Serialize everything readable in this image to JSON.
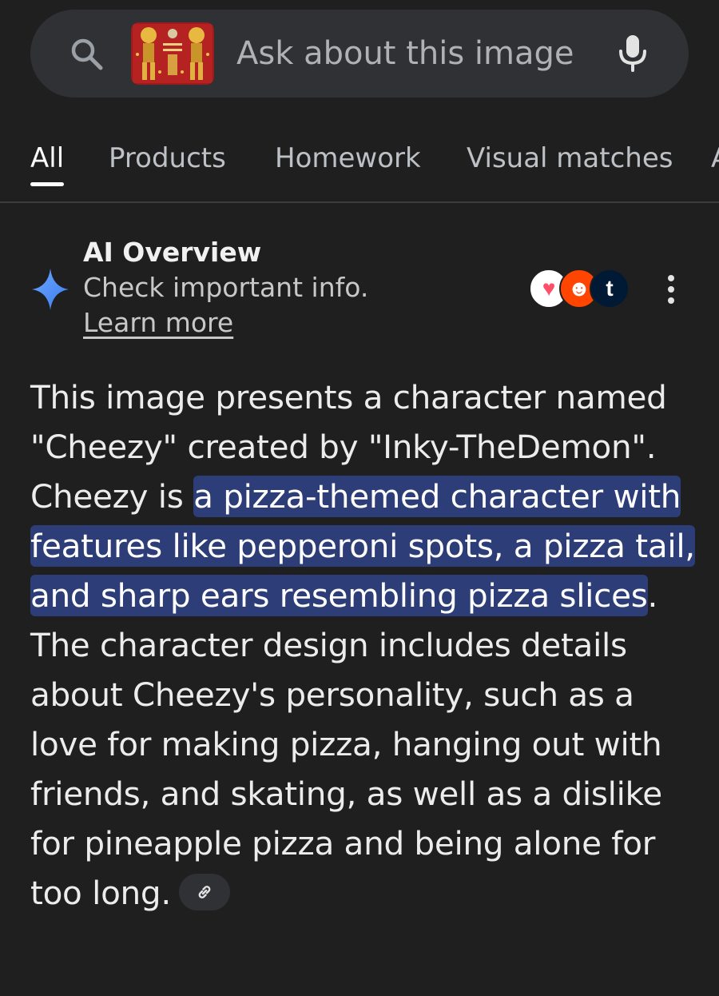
{
  "search": {
    "placeholder": "Ask about this image",
    "thumbnail_icon": "character-sheet-thumbnail",
    "search_icon": "search-icon",
    "mic_icon": "mic-icon"
  },
  "tabs": [
    {
      "label": "All",
      "active": true
    },
    {
      "label": "Products",
      "active": false
    },
    {
      "label": "Homework",
      "active": false
    },
    {
      "label": "Visual matches",
      "active": false
    },
    {
      "label": "A",
      "active": false
    }
  ],
  "ai_overview": {
    "title": "AI Overview",
    "subtitle": "Check important info.",
    "learn_more": "Learn more",
    "sources": [
      {
        "name": "tinder-source-icon",
        "glyph": "♥"
      },
      {
        "name": "reddit-source-icon",
        "glyph": "☻"
      },
      {
        "name": "tumblr-source-icon",
        "glyph": "t"
      }
    ]
  },
  "answer": {
    "part1": "This image presents a character named \"Cheezy\" created by \"Inky-TheDemon\". Cheezy is ",
    "highlight": "a pizza-themed character with features like pepperoni spots, a pizza tail, and sharp ears resembling pizza slices",
    "part2": ". The character design includes details about Cheezy's personality, such as a love for making pizza, hanging out with friends, and skating, as well as a dislike for pineapple pizza and being alone for too long."
  },
  "colors": {
    "background": "#1f1f1f",
    "search_bar": "#303134",
    "highlight": "#2c3d78",
    "sparkle": "#4d8ef5"
  }
}
